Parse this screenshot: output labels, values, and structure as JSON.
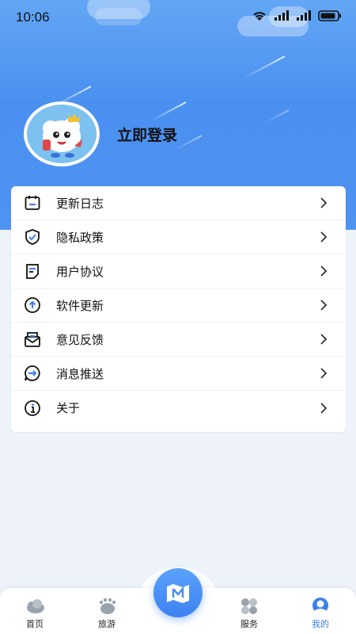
{
  "status_bar": {
    "time": "10:06"
  },
  "profile": {
    "login_label": "立即登录"
  },
  "menu": {
    "items": [
      {
        "label": "更新日志",
        "icon": "calendar-icon"
      },
      {
        "label": "隐私政策",
        "icon": "shield-icon"
      },
      {
        "label": "用户协议",
        "icon": "document-icon"
      },
      {
        "label": "软件更新",
        "icon": "upload-icon"
      },
      {
        "label": "意见反馈",
        "icon": "mail-icon"
      },
      {
        "label": "消息推送",
        "icon": "message-arrow-icon"
      },
      {
        "label": "关于",
        "icon": "info-icon"
      }
    ]
  },
  "tabbar": {
    "tabs": [
      {
        "label": "首页",
        "icon": "cloud-home-icon"
      },
      {
        "label": "旅游",
        "icon": "footprint-icon"
      },
      {
        "label": "服务",
        "icon": "grid-icon"
      },
      {
        "label": "我的",
        "icon": "user-icon",
        "active": true
      }
    ],
    "center_icon": "map-icon"
  },
  "colors": {
    "accent": "#3b7ff0",
    "hero": "#4f93f1",
    "background": "#eef3fa"
  }
}
